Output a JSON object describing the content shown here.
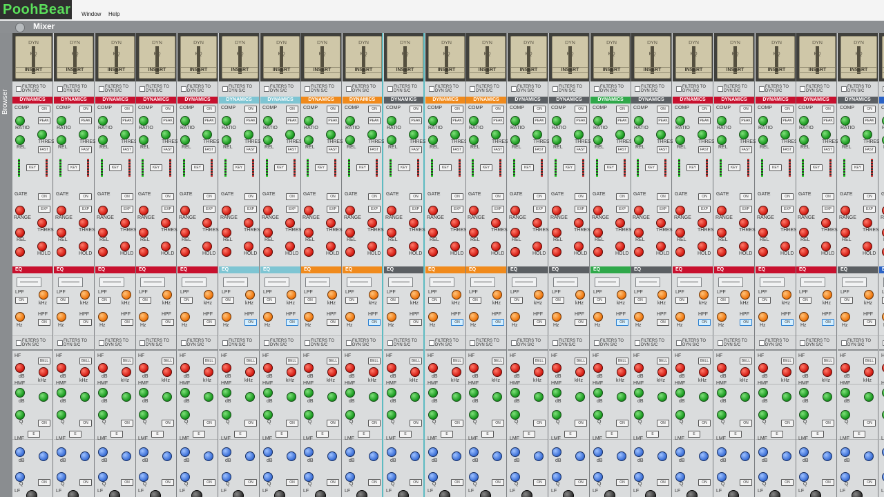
{
  "app": {
    "logo_text": "PoohBear",
    "menu": [
      "Window",
      "Help"
    ],
    "mixer_title": "Mixer",
    "browser_label": "Browser"
  },
  "insert": {
    "dyn": "DYN",
    "eq": "EQ",
    "insert": "INSERT"
  },
  "filters": {
    "line1": "FILTERS TO",
    "line2": "DYN S/C"
  },
  "dynamics": {
    "comp": "COMP",
    "on": "ON",
    "ratio": "RATIO",
    "peak": "PEAK",
    "thres": "THRES",
    "rel": "REL",
    "fast": "FAST",
    "key": "KEY",
    "gate": "GATE",
    "exp": "EXP",
    "range": "RANGE",
    "hold": "HOLD"
  },
  "eq": {
    "lpf": "LPF",
    "hpf": "HPF",
    "on": "ON",
    "khz": "kHz",
    "hz": "Hz"
  },
  "peq": {
    "hf": "HF",
    "bell": "BELL",
    "hmf": "HMF",
    "lmf": "LMF",
    "lf": "LF",
    "db": "dB",
    "q": "Q",
    "e": "E"
  },
  "strips": [
    {
      "dyn_label": "DYNAMICS",
      "dyn_color": "#c8102e",
      "eq_label": "EQ",
      "eq_color": "#c8102e",
      "hpf_on": false
    },
    {
      "dyn_label": "DYNAMICS",
      "dyn_color": "#c8102e",
      "eq_label": "EQ",
      "eq_color": "#c8102e",
      "hpf_on": false
    },
    {
      "dyn_label": "DYNAMICS",
      "dyn_color": "#c8102e",
      "eq_label": "EQ",
      "eq_color": "#c8102e",
      "hpf_on": false
    },
    {
      "dyn_label": "DYNAMICS",
      "dyn_color": "#c8102e",
      "eq_label": "EQ",
      "eq_color": "#c8102e",
      "hpf_on": false
    },
    {
      "dyn_label": "DYNAMICS",
      "dyn_color": "#c8102e",
      "eq_label": "EQ",
      "eq_color": "#c8102e",
      "hpf_on": false
    },
    {
      "dyn_label": "DYNAMICS",
      "dyn_color": "#7ec5d3",
      "eq_label": "EQ",
      "eq_color": "#7ec5d3",
      "hpf_on": true
    },
    {
      "dyn_label": "DYNAMICS",
      "dyn_color": "#7ec5d3",
      "eq_label": "EQ",
      "eq_color": "#7ec5d3",
      "hpf_on": true
    },
    {
      "dyn_label": "DYNAMICS",
      "dyn_color": "#f08a1c",
      "eq_label": "EQ",
      "eq_color": "#f08a1c",
      "hpf_on": false
    },
    {
      "dyn_label": "DYNAMICS",
      "dyn_color": "#f08a1c",
      "eq_label": "EQ",
      "eq_color": "#f08a1c",
      "hpf_on": true
    },
    {
      "dyn_label": "DYNAMICS",
      "dyn_color": "#5b5f63",
      "eq_label": "EQ",
      "eq_color": "#5b5f63",
      "hpf_on": false
    },
    {
      "dyn_label": "DYNAMICS",
      "dyn_color": "#f08a1c",
      "eq_label": "EQ",
      "eq_color": "#f08a1c",
      "hpf_on": true
    },
    {
      "dyn_label": "DYNAMICS",
      "dyn_color": "#f08a1c",
      "eq_label": "EQ",
      "eq_color": "#f08a1c",
      "hpf_on": true
    },
    {
      "dyn_label": "DYNAMICS",
      "dyn_color": "#5b5f63",
      "eq_label": "EQ",
      "eq_color": "#5b5f63",
      "hpf_on": false
    },
    {
      "dyn_label": "DYNAMICS",
      "dyn_color": "#5b5f63",
      "eq_label": "EQ",
      "eq_color": "#5b5f63",
      "hpf_on": false
    },
    {
      "dyn_label": "DYNAMICS",
      "dyn_color": "#2fa84a",
      "eq_label": "EQ",
      "eq_color": "#2fa84a",
      "hpf_on": true
    },
    {
      "dyn_label": "DYNAMICS",
      "dyn_color": "#5b5f63",
      "eq_label": "EQ",
      "eq_color": "#5b5f63",
      "hpf_on": false
    },
    {
      "dyn_label": "DYNAMICS",
      "dyn_color": "#c8102e",
      "eq_label": "EQ",
      "eq_color": "#c8102e",
      "hpf_on": true
    },
    {
      "dyn_label": "DYNAMICS",
      "dyn_color": "#c8102e",
      "eq_label": "EQ",
      "eq_color": "#c8102e",
      "hpf_on": true
    },
    {
      "dyn_label": "DYNAMICS",
      "dyn_color": "#c8102e",
      "eq_label": "EQ",
      "eq_color": "#c8102e",
      "hpf_on": true
    },
    {
      "dyn_label": "DYNAMICS",
      "dyn_color": "#c8102e",
      "eq_label": "EQ",
      "eq_color": "#c8102e",
      "hpf_on": true
    },
    {
      "dyn_label": "DYNAMICS",
      "dyn_color": "#5b5f63",
      "eq_label": "EQ",
      "eq_color": "#5b5f63",
      "hpf_on": false
    },
    {
      "dyn_label": "DYNAMICS",
      "dyn_color": "#2a62c5",
      "eq_label": "EQ",
      "eq_color": "#2a62c5",
      "hpf_on": false
    }
  ]
}
